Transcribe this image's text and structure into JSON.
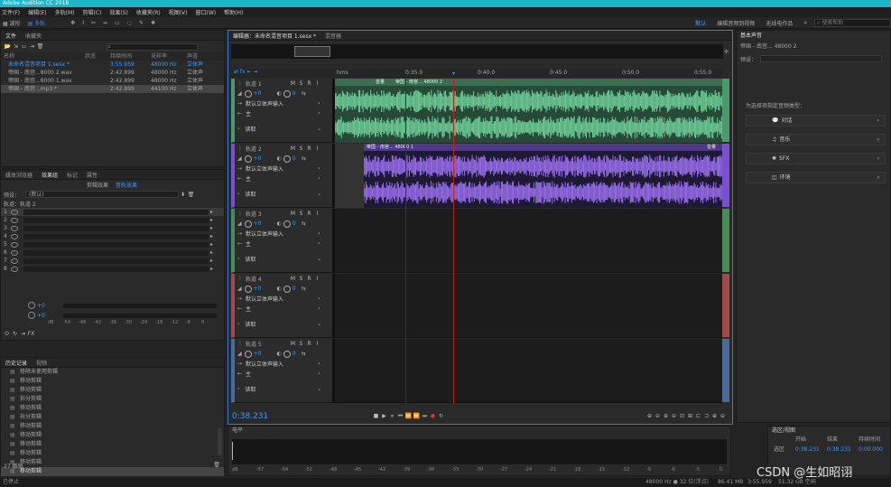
{
  "title_bar": {
    "text": "Adobe Audition CC 2018"
  },
  "menu": [
    "文件(F)",
    "编辑(E)",
    "多轨(M)",
    "剪辑(C)",
    "效果(S)",
    "收藏夹(R)",
    "视图(V)",
    "窗口(W)",
    "帮助(H)"
  ],
  "toolbar": {
    "waveform_label": "波形",
    "multitrack_label": "多轨",
    "workspace_active": "默认",
    "workspace_2": "编辑音频到视频",
    "workspace_3": "无线电作品",
    "more": "»",
    "search_placeholder": "搜索帮助"
  },
  "files_panel": {
    "tabs": [
      "文件",
      "收藏夹"
    ],
    "search_placeholder": "",
    "headers": [
      "名称",
      "状态",
      "持续时间",
      "采样率",
      "声道"
    ],
    "rows": [
      {
        "name": "未命名混音项目 1.sesx *",
        "status": "",
        "duration": "3:55.959",
        "rate": "48000 Hz",
        "ch": "立体声",
        "selected": false,
        "color": "#3e98f5"
      },
      {
        "name": "帝国 - 南宫...8000 2.wav",
        "status": "",
        "duration": "2:42.899",
        "rate": "48000 Hz",
        "ch": "立体声",
        "selected": false,
        "color": "#a8a8a8"
      },
      {
        "name": "帝国 - 南宫...8000 1.wav",
        "status": "",
        "duration": "2:42.899",
        "rate": "48000 Hz",
        "ch": "立体声",
        "selected": false,
        "color": "#a8a8a8"
      },
      {
        "name": "帝国 - 南宫...mp3 *",
        "status": "",
        "duration": "2:42.899",
        "rate": "44100 Hz",
        "ch": "立体声",
        "selected": true,
        "color": "#a8a8a8"
      }
    ]
  },
  "effects_panel": {
    "tabs": [
      "媒体浏览器",
      "效果组",
      "标记",
      "属性"
    ],
    "subtabs": [
      "剪辑效果",
      "音轨效果"
    ],
    "preset_label": "预设：",
    "preset_value": "(默认)",
    "track_label": "轨道：轨道 2",
    "slots": [
      "1",
      "2",
      "3",
      "4",
      "5",
      "6",
      "7",
      "8"
    ],
    "fx_label": "FX",
    "meter_values": [
      "+0",
      "+0"
    ],
    "meter_scale": [
      "dB",
      "-54",
      "-48",
      "-42",
      "-36",
      "-30",
      "-24",
      "-18",
      "-12",
      "-6",
      "0"
    ]
  },
  "history_panel": {
    "tabs": [
      "历史记录",
      "视频"
    ],
    "items": [
      "移除未使用剪辑",
      "移动剪辑",
      "移动剪辑",
      "拆分剪辑",
      "移动剪辑",
      "拆分剪辑",
      "移动剪辑",
      "移动剪辑",
      "移动剪辑",
      "移动剪辑",
      "移动剪辑",
      "移动剪辑"
    ],
    "count": "27 撤销"
  },
  "editor": {
    "tabs": [
      "编辑器：未命名混音项目 1.sesx *",
      "混音器"
    ],
    "time_format": "hms",
    "ruler": [
      "0:35.0",
      "0:40.0",
      "0:45.0",
      "0:50.0",
      "0:55.0"
    ],
    "clip1_label": "帝国 - 南宫... 48000 2",
    "clip1_prefix": "音量",
    "clip2_label": "帝国 - 南宫... 48000 1",
    "clip2_right": "音量",
    "time": "0:38.231",
    "tracks": [
      {
        "name": "轨道 1",
        "color": "#4c9a6c",
        "vol": "+0",
        "input": "默认立体声输入",
        "output": "主",
        "mode": "读取"
      },
      {
        "name": "轨道 2",
        "color": "#7b4fd1",
        "vol": "+0",
        "input": "默认立体声输入",
        "output": "主",
        "mode": "读取"
      },
      {
        "name": "轨道 3",
        "color": "#4a8c58",
        "vol": "+0",
        "input": "默认立体声输入",
        "output": "主",
        "mode": "读取"
      },
      {
        "name": "轨道 4",
        "color": "#a04a4a",
        "vol": "+0",
        "input": "默认立体声输入",
        "output": "主",
        "mode": "读取"
      },
      {
        "name": "轨道 5",
        "color": "#4a6a9a",
        "vol": "+0",
        "input": "默认立体声输入",
        "output": "主",
        "mode": "读取"
      }
    ],
    "track_buttons": [
      "M",
      "S",
      "R"
    ]
  },
  "essential_sound": {
    "title": "基本声音",
    "subtitle": "帝国 - 南宫... 48000 2",
    "preset_label": "预设：",
    "hint": "为选择项指定音频类型：",
    "types": [
      "对话",
      "音乐",
      "SFX",
      "环境"
    ]
  },
  "levels_panel": {
    "title": "电平",
    "scale": [
      "dB",
      "-57",
      "-54",
      "-51",
      "-48",
      "-45",
      "-42",
      "-39",
      "-36",
      "-33",
      "-30",
      "-27",
      "-24",
      "-21",
      "-18",
      "-15",
      "-12",
      "-9",
      "-6",
      "-3",
      "0"
    ]
  },
  "selection_panel": {
    "title": "选区/视图",
    "headers": [
      "开始",
      "结束",
      "持续时间"
    ],
    "row_label": "选区",
    "start": "0:38.231",
    "end": "0:38.231",
    "duration": "0:00.000"
  },
  "status": {
    "left": "已停止",
    "rate": "48000 Hz ● 32 位(浮点)",
    "size": "86.41 MB",
    "length": "3:55.959",
    "free": "51.32 GB 空闲",
    "watermark": "CSDN @生如昭诩"
  }
}
